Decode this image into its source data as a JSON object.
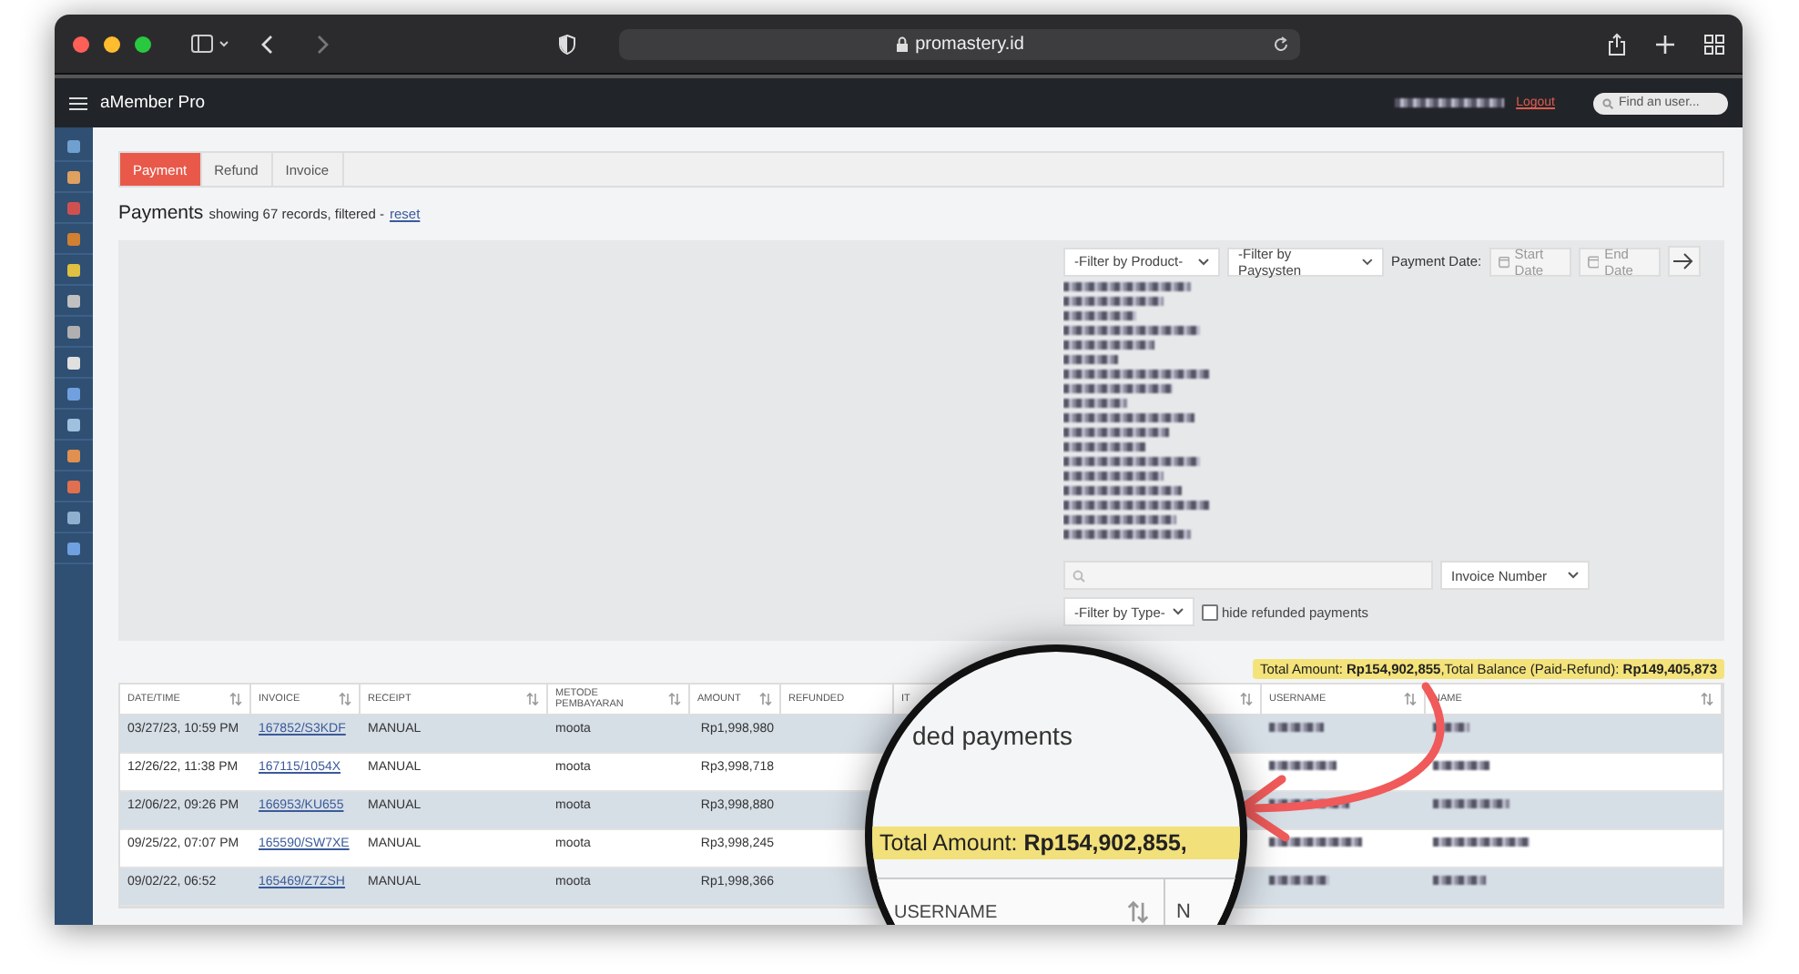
{
  "browser": {
    "url": "promastery.id"
  },
  "header": {
    "title": "aMember Pro",
    "logout": "Logout",
    "search": {
      "placeholder": "Find an user..."
    }
  },
  "tabs": [
    {
      "label": "Payment",
      "selected": true
    },
    {
      "label": "Refund",
      "selected": false
    },
    {
      "label": "Invoice",
      "selected": false
    }
  ],
  "page": {
    "title": "Payments",
    "summary": "showing 67 records, filtered - ",
    "reset": "reset"
  },
  "filters": {
    "product": "-Filter by Product-",
    "paysystem": "-Filter by Paysysten",
    "date_label": "Payment Date:",
    "start_date": {
      "placeholder": "Start Date"
    },
    "end_date": {
      "placeholder": "End Date"
    },
    "search_by": "Invoice Number",
    "type": "-Filter by Type-",
    "hide_refunded": {
      "label": "hide refunded payments",
      "checked": false
    }
  },
  "totals": "Total Amount: **Rp154,902,855**,Total Balance (Paid-Refund): **Rp149,405,873**",
  "table": {
    "columns": [
      {
        "label": "DATE/TIME",
        "sortable": true
      },
      {
        "label": "INVOICE",
        "sortable": true
      },
      {
        "label": "RECEIPT",
        "sortable": true
      },
      {
        "label": "METODE PEMBAYARAN",
        "sortable": true
      },
      {
        "label": "AMOUNT",
        "sortable": true
      },
      {
        "label": "REFUNDED",
        "sortable": false
      },
      {
        "label": "IT",
        "sortable": true
      },
      {
        "label": "USERNAME",
        "sortable": true
      },
      {
        "label": "NAME",
        "sortable": true
      }
    ],
    "rows": [
      {
        "date": "03/27/23, 10:59 PM",
        "invoice": "167852/S3KDF",
        "receipt": "MANUAL",
        "method": "moota",
        "amount": "Rp1,998,980"
      },
      {
        "date": "12/26/22, 11:38 PM",
        "invoice": "167115/1054X",
        "receipt": "MANUAL",
        "method": "moota",
        "amount": "Rp3,998,718"
      },
      {
        "date": "12/06/22, 09:26 PM",
        "invoice": "166953/KU655",
        "receipt": "MANUAL",
        "method": "moota",
        "amount": "Rp3,998,880"
      },
      {
        "date": "09/25/22, 07:07 PM",
        "invoice": "165590/SW7XE",
        "receipt": "MANUAL",
        "method": "moota",
        "amount": "Rp3,998,245"
      },
      {
        "date": "09/02/22, 06:52",
        "invoice": "165469/Z7ZSH",
        "receipt": "MANUAL",
        "method": "moota",
        "amount": "Rp1,998,366"
      }
    ]
  },
  "magnifier": {
    "text": "ded payments",
    "total_label": "Total Amount:",
    "total_value": "Rp154,902,855,",
    "column": "USERNAME",
    "column_next": "N"
  }
}
